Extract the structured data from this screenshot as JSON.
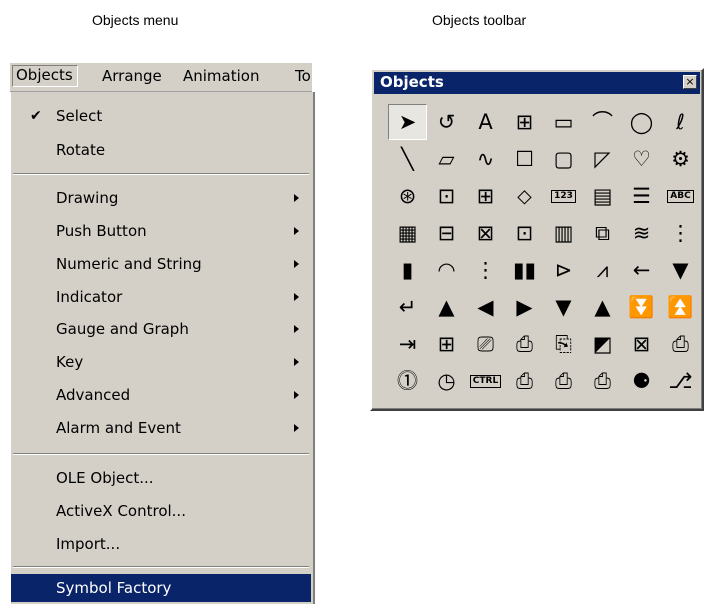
{
  "captions": {
    "menu": "Objects menu",
    "toolbar": "Objects toolbar"
  },
  "menubar": {
    "items": [
      "Objects",
      "Arrange",
      "Animation",
      "To"
    ]
  },
  "menu": {
    "select": "Select",
    "rotate": "Rotate",
    "drawing": "Drawing",
    "push_button": "Push Button",
    "numeric_string": "Numeric and  String",
    "indicator": "Indicator",
    "gauge_graph": "Gauge and Graph",
    "key": "Key",
    "advanced": "Advanced",
    "alarm_event": "Alarm and Event",
    "ole_object": "OLE Object...",
    "activex": "ActiveX Control...",
    "import": "Import...",
    "symbol_factory": "Symbol Factory"
  },
  "toolbar": {
    "title": "Objects",
    "close": "×",
    "glyphs": {
      "select": "➤",
      "rotate": "↺",
      "text": "A",
      "wrap": "⊞",
      "rect_flat": "▭",
      "arc": "⌒",
      "ellipse": "◯",
      "freehand": "ℓ",
      "line": "╲",
      "parallelogram": "▱",
      "polyline": "∿",
      "square": "☐",
      "rounded": "▢",
      "pie": "◸",
      "heart": "♡",
      "gear": "⚙",
      "r3c1": "⊛",
      "r3c2": "⊡",
      "r3c3": "⊞",
      "r3c4": "⬦",
      "r3c5": "123",
      "r3c6": "▤",
      "r3c7": "☰",
      "r3c8": "ABC",
      "r4c1": "▦",
      "r4c2": "⊟",
      "r4c3": "⊠",
      "r4c4": "⊡",
      "r4c5": "▥",
      "r4c6": "⧉",
      "r4c7": "≋",
      "r4c8": "⋮",
      "r5c1": "▮",
      "r5c2": "◠",
      "r5c3": "⋮",
      "r5c4": "▮▮",
      "r5c5": "⊳",
      "r5c6": "⩘",
      "r5c7": "←",
      "r5c8": "▼",
      "r6c1": "↵",
      "r6c2": "▲",
      "r6c3": "◀",
      "r6c4": "▶",
      "r6c5": "▼",
      "r6c6": "▲",
      "r6c7": "⏬",
      "r6c8": "⏫",
      "r7c1": "⇥",
      "r7c2": "⊞",
      "r7c3": "⎚",
      "r7c4": "⎙",
      "r7c5": "⎘",
      "r7c6": "◩",
      "r7c7": "⊠",
      "r7c8": "⎙",
      "r8c1": "⓵",
      "r8c2": "◷",
      "r8c3": "CTRL",
      "r8c4": "⎙",
      "r8c5": "⎙",
      "r8c6": "⎙",
      "r8c7": "⚈",
      "r8c8": "⎇"
    }
  }
}
